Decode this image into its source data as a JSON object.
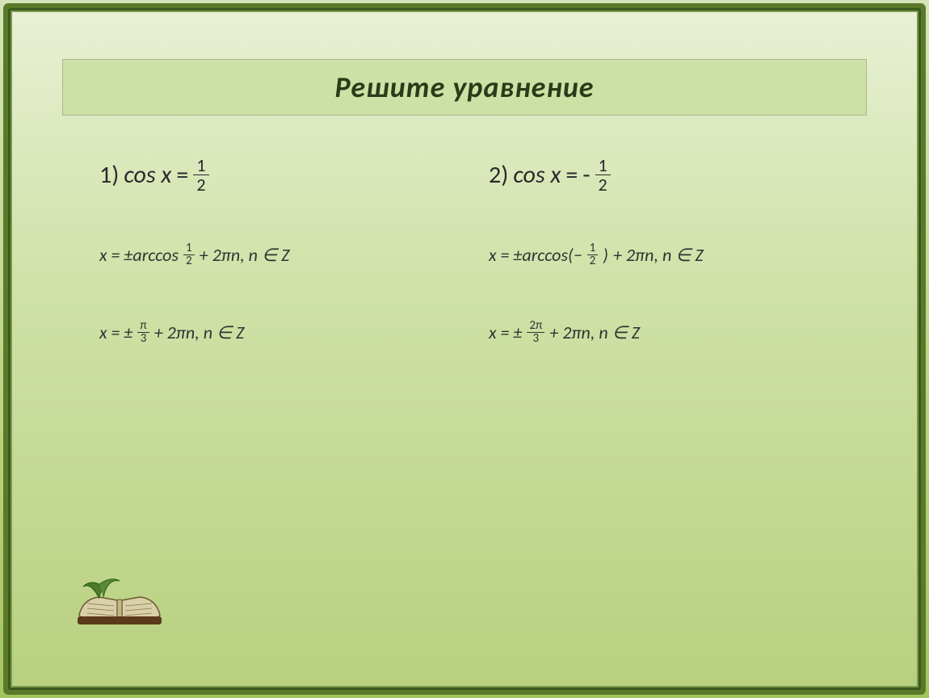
{
  "title": "Решите   уравнение",
  "problems": [
    {
      "label": "1)",
      "expr_lhs": "cos x",
      "expr_eq": "=",
      "frac_top": "1",
      "frac_bot": "2",
      "sign": "",
      "sol1_prefix": "x =  ±arccos",
      "sol1_frac_top": "1",
      "sol1_frac_bot": "2",
      "sol1_suffix": "+  2πn, n ∈ Z",
      "sol2_prefix": "x =  ±",
      "sol2_frac_top": "π",
      "sol2_frac_bot": "3",
      "sol2_suffix": "+  2πn, n ∈ Z"
    },
    {
      "label": "2)",
      "expr_lhs": "cos x",
      "expr_eq": "=",
      "frac_top": "1",
      "frac_bot": "2",
      "sign": "-",
      "sol1_prefix": "x =  ±arccos(−",
      "sol1_frac_top": "1",
      "sol1_frac_bot": "2",
      "sol1_close": ")",
      "sol1_suffix": " +  2πn, n ∈ Z",
      "sol2_prefix": "x =  ±",
      "sol2_frac_top": "2π",
      "sol2_frac_bot": "3",
      "sol2_suffix": "+  2πn, n ∈ Z"
    }
  ]
}
